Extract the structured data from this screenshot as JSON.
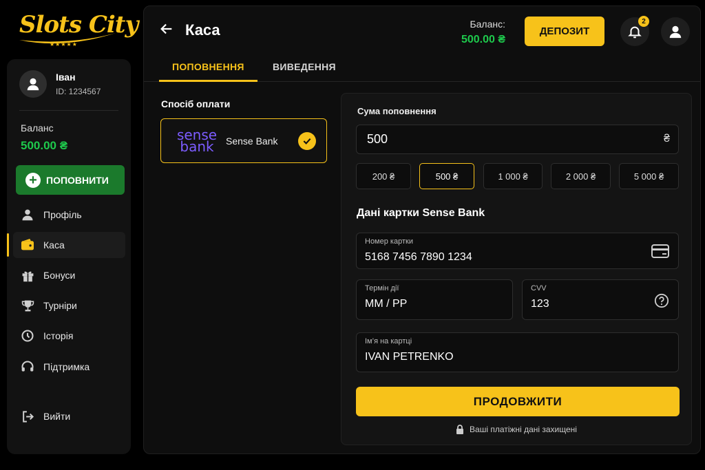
{
  "brand": {
    "name": "Slots City",
    "stars": "★★★★★",
    "color": "#f7c21a"
  },
  "sidebar": {
    "user": {
      "name": "Іван",
      "id": "ID: 1234567"
    },
    "balance_label": "Баланс",
    "balance_value": "500.00 ₴",
    "topup_label": "ПОПОВНИТИ",
    "items": [
      {
        "label": "Профіль",
        "icon": "user-icon"
      },
      {
        "label": "Каса",
        "icon": "wallet-icon",
        "active": true
      },
      {
        "label": "Бонуси",
        "icon": "gift-icon"
      },
      {
        "label": "Турніри",
        "icon": "trophy-icon"
      },
      {
        "label": "Історія",
        "icon": "history-icon"
      },
      {
        "label": "Підтримка",
        "icon": "headset-icon"
      }
    ],
    "logout_label": "Вийти"
  },
  "header": {
    "title": "Каса",
    "balance_label": "Баланс:",
    "balance_value": "500.00 ₴",
    "deposit_label": "ДЕПОЗИТ",
    "notifications_count": "2"
  },
  "tabs": [
    {
      "label": "ПОПОВНЕННЯ",
      "active": true
    },
    {
      "label": "ВИВЕДЕННЯ",
      "active": false
    }
  ],
  "payment": {
    "method_label": "Спосіб оплати",
    "method": {
      "logo_top": "sense",
      "logo_bottom": "bank",
      "name": "Sense Bank",
      "selected": true
    }
  },
  "form": {
    "amount_label": "Сума поповнення",
    "amount_value": "500",
    "currency": "₴",
    "quick_amounts": [
      "200 ₴",
      "500 ₴",
      "1 000 ₴",
      "2 000 ₴",
      "5 000 ₴"
    ],
    "selected_amount_index": 1,
    "card_title": "Дані картки Sense Bank",
    "card_number": {
      "label": "Номер картки",
      "value": "5168 7456 7890 1234"
    },
    "expiry": {
      "label": "Термін дії",
      "value": "MM / PP"
    },
    "cvv": {
      "label": "CVV",
      "value": "123"
    },
    "holder": {
      "label": "Ім’я на картці",
      "value": "IVAN PETRENKO"
    },
    "continue_label": "ПРОДОВЖИТИ",
    "secure_text": "Ваші платіжні дані захищені"
  },
  "colors": {
    "accent": "#f7c21a",
    "success": "#1ec94c",
    "topup_button": "#1b7a2c",
    "sense_purple": "#7c5cff"
  }
}
